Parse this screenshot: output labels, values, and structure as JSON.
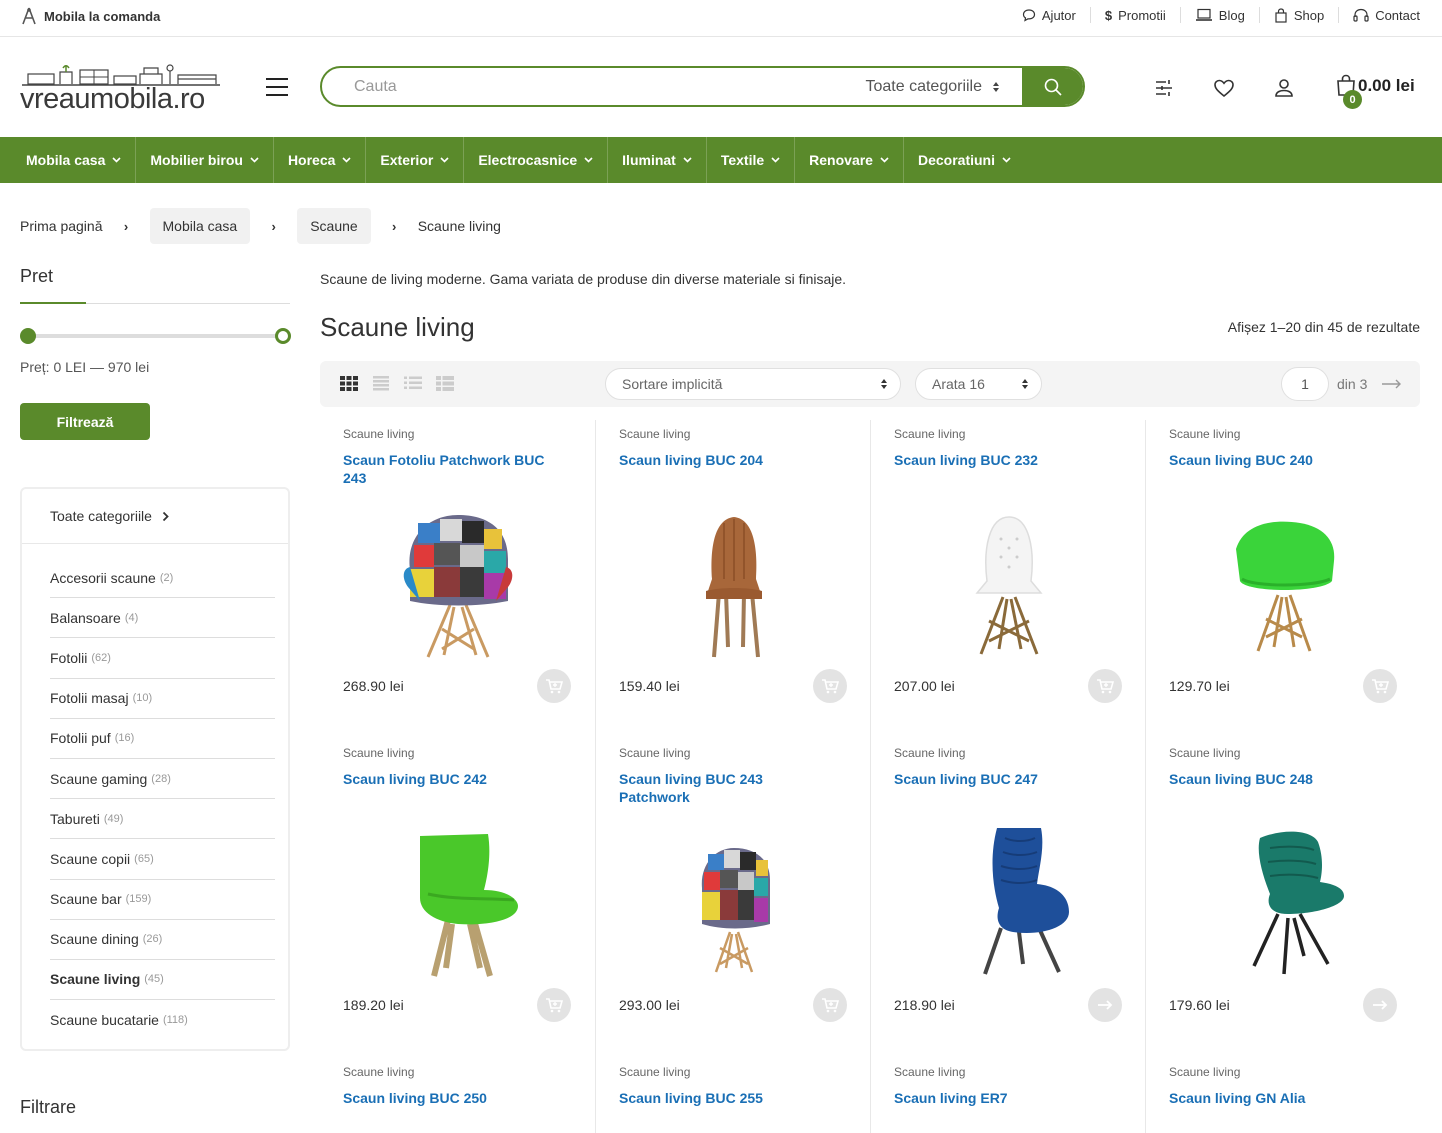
{
  "topbar": {
    "promo": "Mobila la comanda",
    "links": [
      "Ajutor",
      "Promotii",
      "Blog",
      "Shop",
      "Contact"
    ]
  },
  "header": {
    "logo_text": "vreaumobila.ro",
    "search_placeholder": "Cauta",
    "search_category": "Toate categoriile",
    "cart_count": "0",
    "cart_amount": "0.00 lei"
  },
  "nav": [
    "Mobila casa",
    "Mobilier birou",
    "Horeca",
    "Exterior",
    "Electrocasnice",
    "Iluminat",
    "Textile",
    "Renovare",
    "Decoratiuni"
  ],
  "breadcrumb": [
    "Prima pagină",
    "Mobila casa",
    "Scaune",
    "Scaune living"
  ],
  "sidebar": {
    "price_title": "Pret",
    "price_label": "Preț: 0 LEI — 970 lei",
    "filter_button": "Filtrează",
    "all_categories": "Toate categoriile",
    "categories": [
      {
        "name": "Accesorii scaune",
        "count": "(2)"
      },
      {
        "name": "Balansoare",
        "count": "(4)"
      },
      {
        "name": "Fotolii",
        "count": "(62)"
      },
      {
        "name": "Fotolii masaj",
        "count": "(10)"
      },
      {
        "name": "Fotolii puf",
        "count": "(16)"
      },
      {
        "name": "Scaune gaming",
        "count": "(28)"
      },
      {
        "name": "Tabureti",
        "count": "(49)"
      },
      {
        "name": "Scaune copii",
        "count": "(65)"
      },
      {
        "name": "Scaune bar",
        "count": "(159)"
      },
      {
        "name": "Scaune dining",
        "count": "(26)"
      },
      {
        "name": "Scaune living",
        "count": "(45)",
        "active": true
      },
      {
        "name": "Scaune bucatarie",
        "count": "(118)"
      }
    ],
    "filters_title": "Filtrare"
  },
  "main": {
    "intro": "Scaune de living moderne. Gama variata de produse din diverse materiale si finisaje.",
    "title": "Scaune living",
    "result_count": "Afișez 1–20 din 45 de rezultate",
    "sort": "Sortare implicită",
    "show": "Arata 16",
    "page": "1",
    "page_total": "din 3"
  },
  "products": [
    {
      "category": "Scaune living",
      "name": "Scaun Fotoliu Patchwork BUC 243",
      "price": "268.90 lei",
      "image": "patchwork-armchair",
      "action": "add-to-cart"
    },
    {
      "category": "Scaune living",
      "name": "Scaun living BUC 204",
      "price": "159.40 lei",
      "image": "brown-leather-chair",
      "action": "add-to-cart"
    },
    {
      "category": "Scaune living",
      "name": "Scaun living BUC 232",
      "price": "207.00 lei",
      "image": "white-eames-chair",
      "action": "add-to-cart"
    },
    {
      "category": "Scaune living",
      "name": "Scaun living BUC 240",
      "price": "129.70 lei",
      "image": "green-eames-armchair",
      "action": "add-to-cart"
    },
    {
      "category": "Scaune living",
      "name": "Scaun living BUC 242",
      "price": "189.20 lei",
      "image": "green-shell-chair",
      "action": "add-to-cart"
    },
    {
      "category": "Scaune living",
      "name": "Scaun living BUC 243 Patchwork",
      "price": "293.00 lei",
      "image": "patchwork-armchair-small",
      "action": "add-to-cart"
    },
    {
      "category": "Scaune living",
      "name": "Scaun living BUC 247",
      "price": "218.90 lei",
      "image": "blue-velvet-chair",
      "action": "view"
    },
    {
      "category": "Scaune living",
      "name": "Scaun living BUC 248",
      "price": "179.60 lei",
      "image": "teal-velvet-chair",
      "action": "view"
    },
    {
      "category": "Scaune living",
      "name": "Scaun living BUC 250",
      "price": "",
      "image": "",
      "action": ""
    },
    {
      "category": "Scaune living",
      "name": "Scaun living BUC 255",
      "price": "",
      "image": "",
      "action": ""
    },
    {
      "category": "Scaune living",
      "name": "Scaun living ER7",
      "price": "",
      "image": "",
      "action": ""
    },
    {
      "category": "Scaune living",
      "name": "Scaun living GN Alia",
      "price": "",
      "image": "",
      "action": ""
    }
  ],
  "colors": {
    "brand": "#5a8a2b",
    "link": "#1a6fb5"
  }
}
